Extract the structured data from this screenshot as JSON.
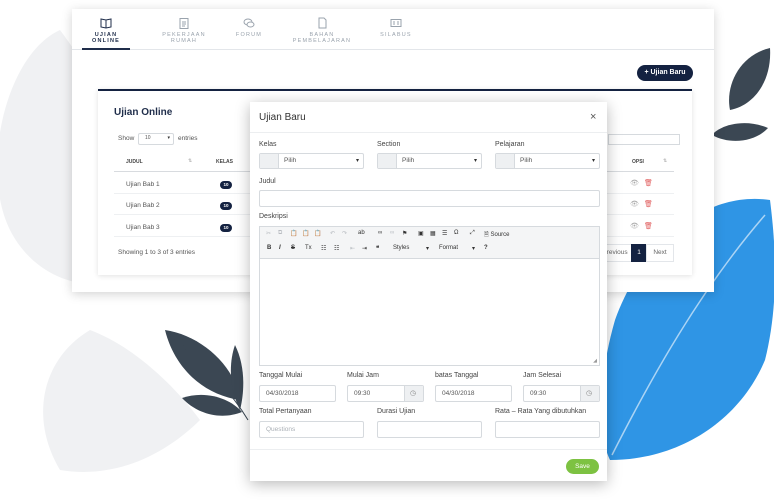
{
  "tabs": [
    {
      "label": "UJIAN ONLINE",
      "icon": "book-icon"
    },
    {
      "label": "PEKERJAAN RUMAH",
      "icon": "clipboard-icon"
    },
    {
      "label": "FORUM",
      "icon": "chat-icon"
    },
    {
      "label": "BAHAN PEMBELAJARAN",
      "icon": "document-icon"
    },
    {
      "label": "SILABUS",
      "icon": "gallery-icon"
    }
  ],
  "toolbar": {
    "new_exam_label": "+ Ujian Baru"
  },
  "card": {
    "title": "Ujian Online",
    "show_label": "Show",
    "show_value": "10",
    "entries_label": "entries",
    "columns": [
      "JUDUL",
      "KELAS",
      "OPSI"
    ],
    "rows": [
      {
        "title": "Ujian Bab 1",
        "kelas": "10"
      },
      {
        "title": "Ujian Bab 2",
        "kelas": "10"
      },
      {
        "title": "Ujian Bab 3",
        "kelas": "10"
      }
    ],
    "info": "Showing 1 to 3 of 3 entries",
    "pagination": {
      "prev": "Previous",
      "page": "1",
      "next": "Next"
    }
  },
  "modal": {
    "title": "Ujian Baru",
    "close": "×",
    "kelas_label": "Kelas",
    "kelas_value": "Pilih",
    "section_label": "Section",
    "section_value": "Pilih",
    "pelajaran_label": "Pelajaran",
    "pelajaran_value": "Pilih",
    "judul_label": "Judul",
    "deskripsi_label": "Deskripsi",
    "editor": {
      "source_label": "Source",
      "styles_label": "Styles",
      "format_label": "Format"
    },
    "tanggal_mulai_label": "Tanggal Mulai",
    "tanggal_mulai_value": "04/30/2018",
    "mulai_jam_label": "Mulai Jam",
    "mulai_jam_value": "09:30",
    "batas_tanggal_label": "batas Tanggal",
    "batas_tanggal_value": "04/30/2018",
    "jam_selesai_label": "Jam Selesai",
    "jam_selesai_value": "09:30",
    "total_pertanyaan_label": "Total Pertanyaan",
    "total_pertanyaan_placeholder": "Questions",
    "durasi_label": "Durasi Ujian",
    "rata_label": "Rata – Rata Yang dibutuhkan",
    "save_label": "Save"
  },
  "colors": {
    "navy": "#142241",
    "leaf_blue": "#2f95e5",
    "leaf_dark": "#3b4753",
    "save_green": "#7dc242"
  }
}
